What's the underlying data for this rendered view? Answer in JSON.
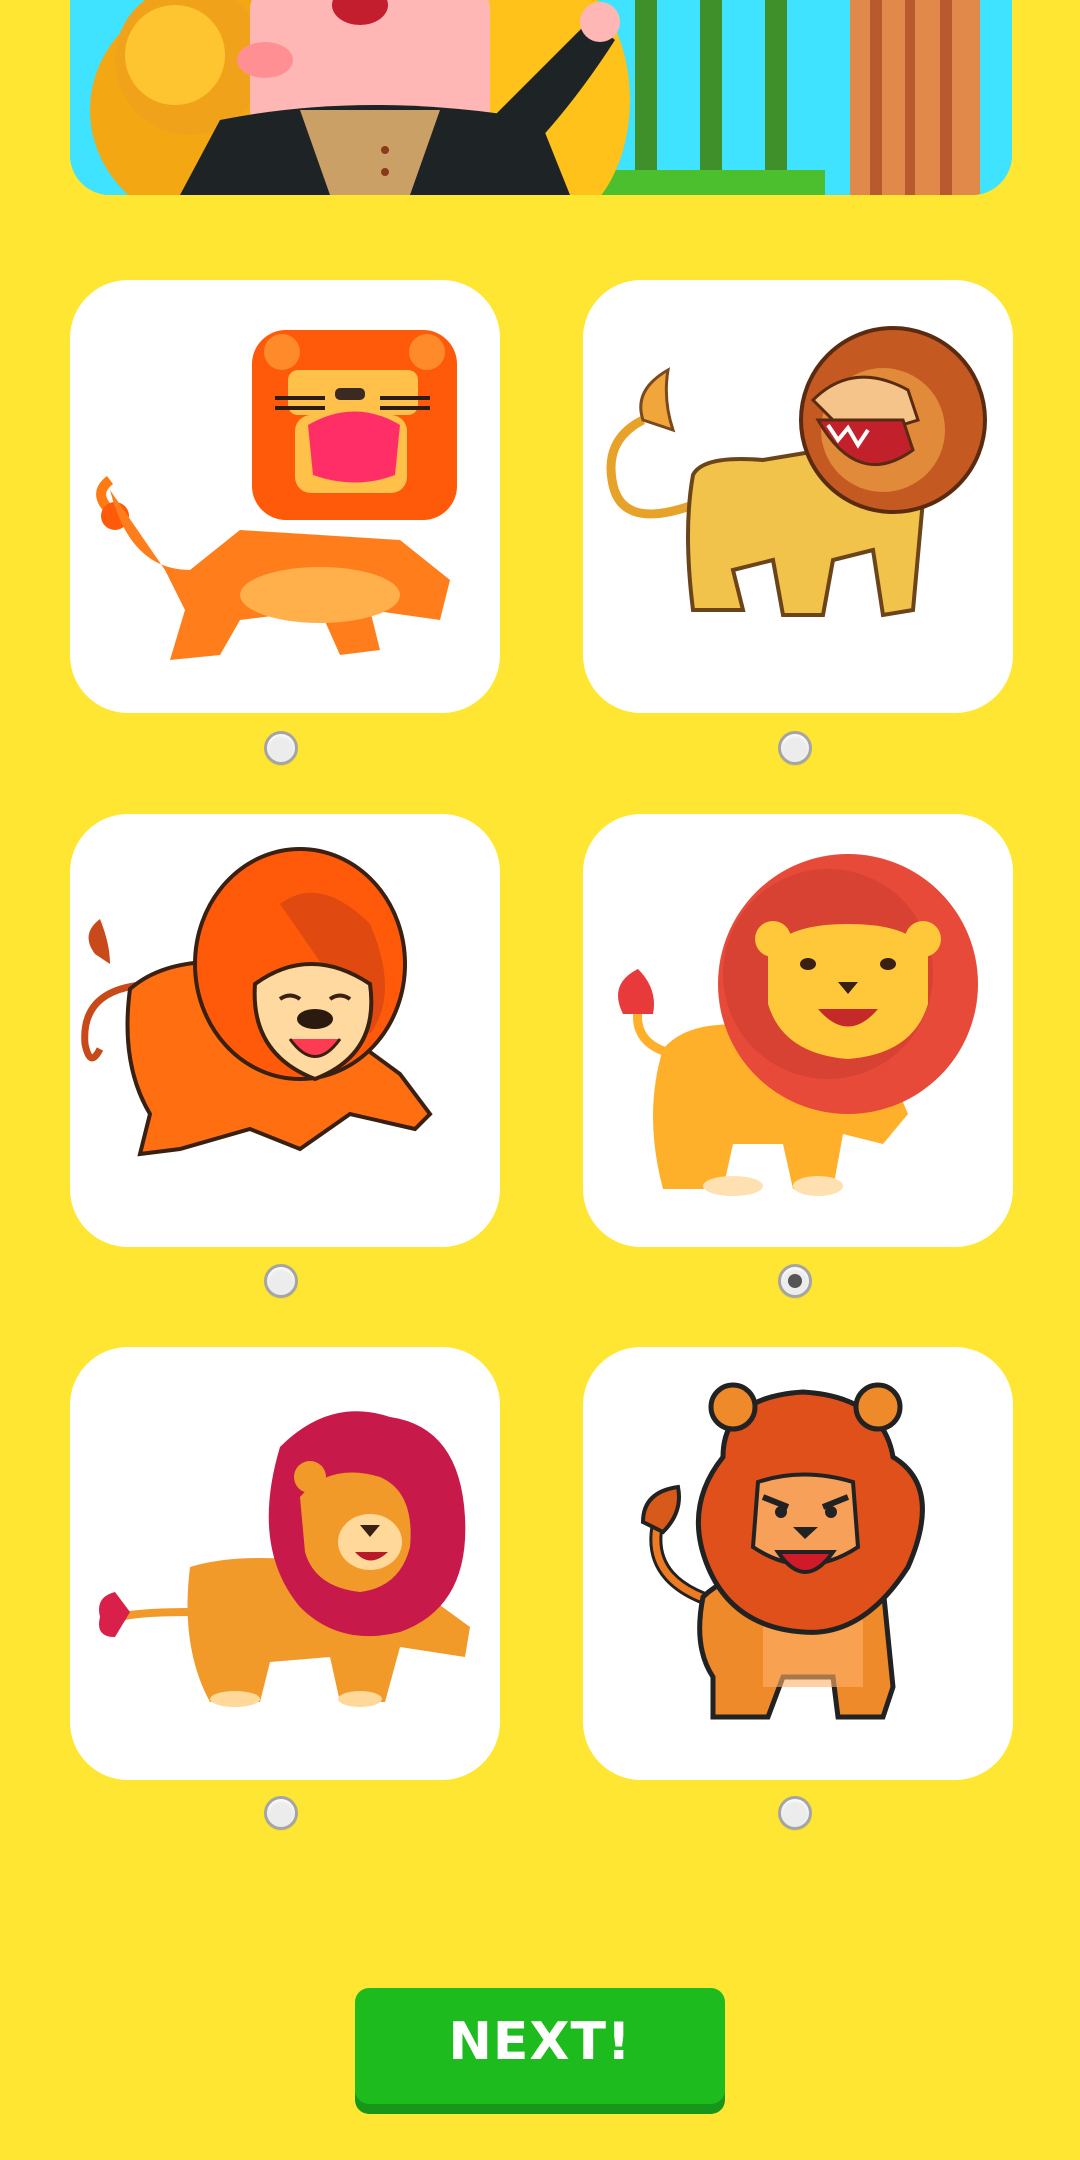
{
  "screen": {
    "background_color": "#FFE632",
    "banner": {
      "icon": "zookeeper-illustration"
    }
  },
  "options": [
    {
      "icon": "lion-geometric-roaring-icon",
      "selected": false
    },
    {
      "icon": "lion-yellow-roaring-icon",
      "selected": false
    },
    {
      "icon": "lion-orange-crouching-icon",
      "selected": false
    },
    {
      "icon": "lion-red-mane-icon",
      "selected": true
    },
    {
      "icon": "lion-magenta-mane-icon",
      "selected": false
    },
    {
      "icon": "lion-fierce-standing-icon",
      "selected": false
    }
  ],
  "actions": {
    "next_label": "NEXT!",
    "next_color": "#1DBB1D"
  }
}
